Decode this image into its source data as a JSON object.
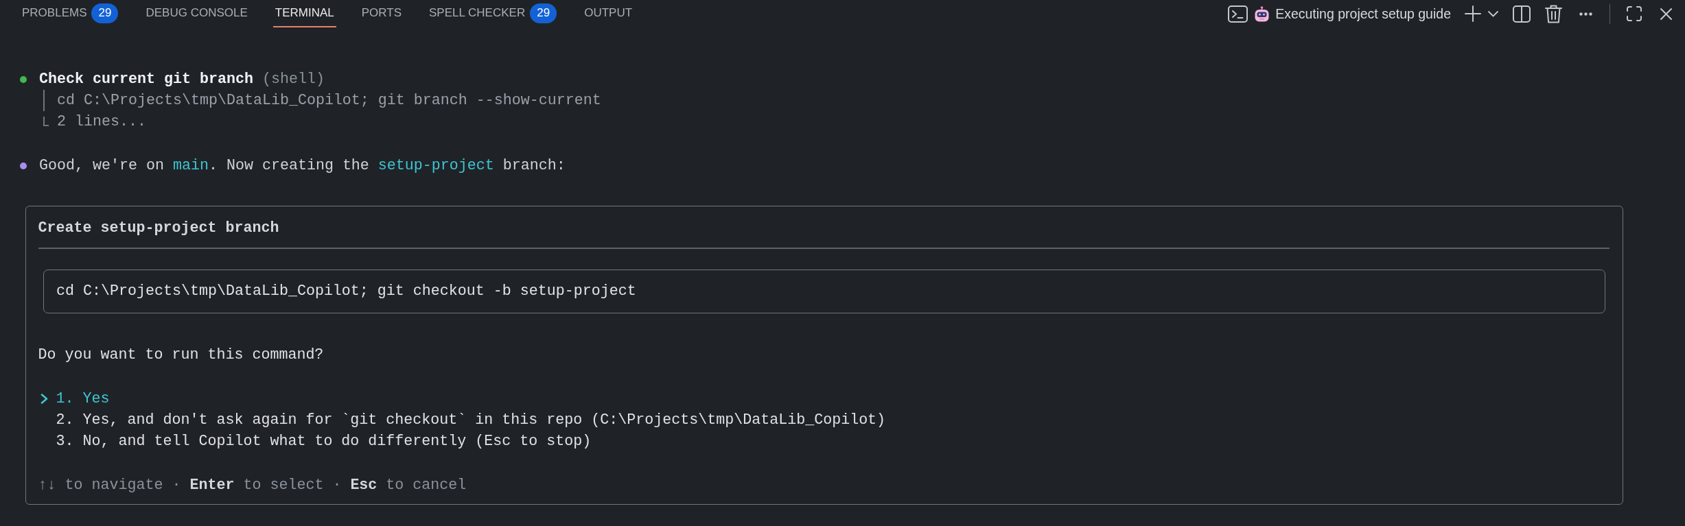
{
  "panel_tabs": [
    {
      "label": "PROBLEMS",
      "badge": "29",
      "selected": false
    },
    {
      "label": "DEBUG CONSOLE",
      "selected": false
    },
    {
      "label": "TERMINAL",
      "selected": true
    },
    {
      "label": "PORTS",
      "selected": false
    },
    {
      "label": "SPELL CHECKER",
      "badge": "29",
      "selected": false
    },
    {
      "label": "OUTPUT",
      "selected": false
    }
  ],
  "terminal_title": "Executing project setup guide",
  "transcript": [
    {
      "kind": "tool_call",
      "color": "#3fb950",
      "title": "Check current git branch",
      "detail": "(shell)",
      "lines": [
        {
          "kind": "command",
          "text": "cd C:\\Projects\\tmp\\DataLib_Copilot; git branch --show-current"
        },
        {
          "kind": "summary",
          "text": "2 lines..."
        }
      ]
    },
    {
      "kind": "message",
      "color": "#a98df0",
      "segments": [
        {
          "kind": "plain",
          "text": "Good, we're on "
        },
        {
          "kind": "code",
          "text": "main"
        },
        {
          "kind": "plain",
          "text": ". Now creating the "
        },
        {
          "kind": "code",
          "text": "setup-project"
        },
        {
          "kind": "plain",
          "text": " branch:"
        }
      ]
    }
  ],
  "confirmation": {
    "title": "Create setup-project branch",
    "command": "cd C:\\Projects\\tmp\\DataLib_Copilot; git checkout -b setup-project",
    "question": "Do you want to run this command?",
    "options": [
      {
        "label": "1. Yes",
        "selected": true
      },
      {
        "label": "2. Yes, and don't ask again for `git checkout` in this repo (C:\\Projects\\tmp\\DataLib_Copilot)",
        "selected": false
      },
      {
        "label": "3. No, and tell Copilot what to do differently (Esc to stop)",
        "selected": false
      }
    ],
    "hint": "↑↓ to navigate · **Enter** to select · **Esc** to cancel"
  }
}
